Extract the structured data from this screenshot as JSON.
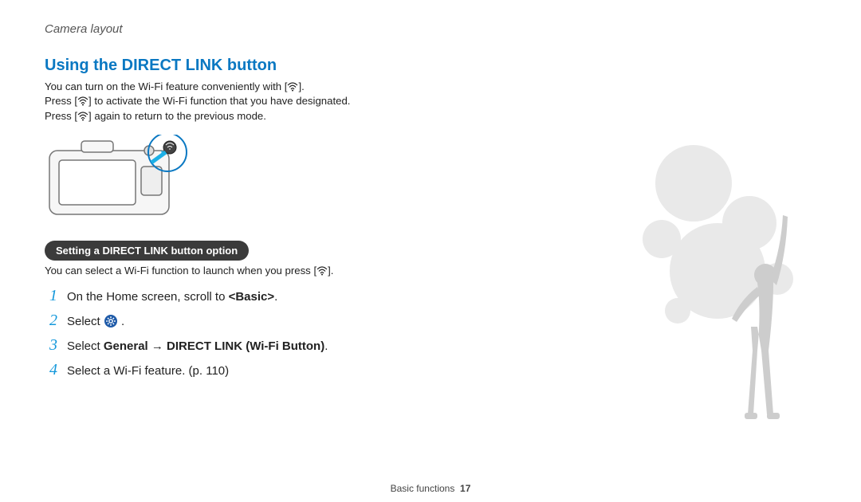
{
  "breadcrumb": "Camera layout",
  "section_title": "Using the DIRECT LINK button",
  "intro": {
    "line1_a": "You can turn on the Wi-Fi feature conveniently with [",
    "line1_b": "].",
    "line2_a": "Press [",
    "line2_b": "] to activate the Wi-Fi function that you have designated.",
    "line3_a": "Press [",
    "line3_b": "] again to return to the previous mode."
  },
  "subsection_pill": "Setting a DIRECT LINK button option",
  "subsection_text_a": "You can select a Wi-Fi function to launch when you press [",
  "subsection_text_b": "].",
  "steps": {
    "s1_a": "On the Home screen, scroll to ",
    "s1_bold": "<Basic>",
    "s1_b": ".",
    "s2_a": "Select ",
    "s2_b": " .",
    "s3_a": "Select ",
    "s3_bold": "General → DIRECT LINK (Wi-Fi Button)",
    "s3_b": ".",
    "s4": "Select a Wi-Fi feature. (p. 110)"
  },
  "footer": {
    "section": "Basic functions",
    "page": "17"
  },
  "icons": {
    "wifi": "wifi-icon",
    "gear": "gear-icon"
  }
}
